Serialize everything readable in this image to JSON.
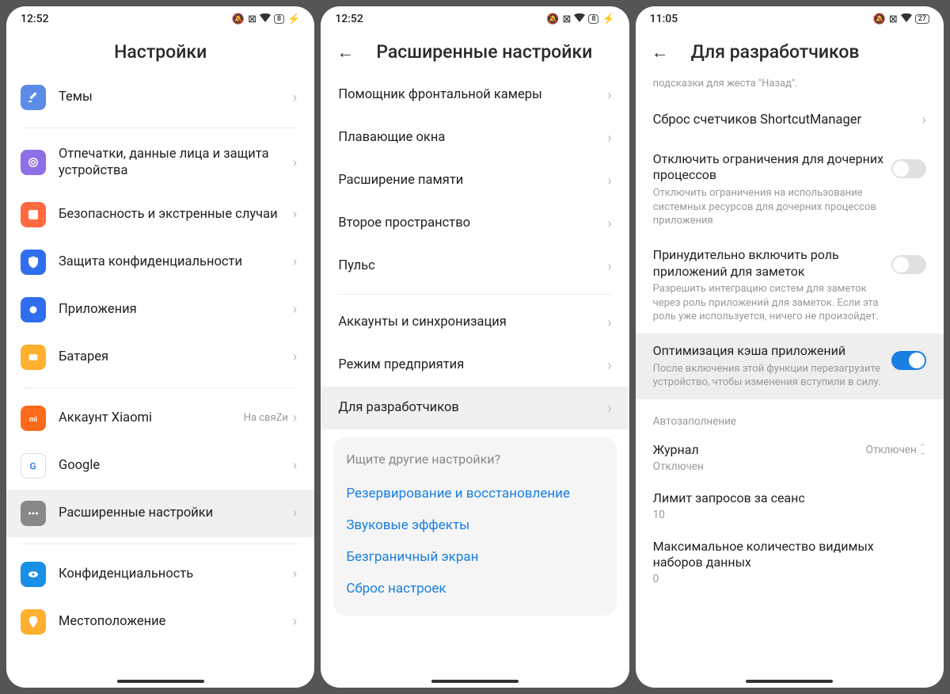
{
  "phone1": {
    "time": "12:52",
    "battery": "8",
    "title": "Настройки",
    "items1": [
      {
        "label": "Темы",
        "color": "#5b8ce8",
        "icon": "brush"
      }
    ],
    "items2": [
      {
        "label": "Отпечатки, данные лица и защита устройства",
        "color": "#8d6fe6",
        "icon": "fingerprint"
      },
      {
        "label": "Безопасность и экстренные случаи",
        "color": "#ff6a3e",
        "icon": "alert"
      },
      {
        "label": "Защита конфиденциальности",
        "color": "#2f6fef",
        "icon": "shield"
      },
      {
        "label": "Приложения",
        "color": "#2f6fef",
        "icon": "apps"
      },
      {
        "label": "Батарея",
        "color": "#ffb02e",
        "icon": "battery"
      }
    ],
    "items3": [
      {
        "label": "Аккаунт Xiaomi",
        "color": "#ff6a1a",
        "icon": "mi",
        "side": "На свяZи"
      },
      {
        "label": "Google",
        "color": "#ffffff",
        "icon": "google"
      },
      {
        "label": "Расширенные настройки",
        "color": "#888888",
        "icon": "dots",
        "highlighted": true
      }
    ],
    "items4": [
      {
        "label": "Конфиденциальность",
        "color": "#1a8fe8",
        "icon": "eye"
      },
      {
        "label": "Местоположение",
        "color": "#ffb02e",
        "icon": "location"
      }
    ]
  },
  "phone2": {
    "time": "12:52",
    "battery": "8",
    "title": "Расширенные настройки",
    "items1": [
      {
        "label": "Помощник фронтальной камеры"
      },
      {
        "label": "Плавающие окна"
      },
      {
        "label": "Расширение памяти"
      },
      {
        "label": "Второе пространство"
      },
      {
        "label": "Пульс"
      }
    ],
    "items2": [
      {
        "label": "Аккаунты и синхронизация"
      },
      {
        "label": "Режим предприятия"
      },
      {
        "label": "Для разработчиков",
        "highlighted": true
      }
    ],
    "suggestions": {
      "prompt": "Ищите другие настройки?",
      "links": [
        "Резервирование и восстановление",
        "Звуковые эффекты",
        "Безграничный экран",
        "Сброс настроек"
      ]
    }
  },
  "phone3": {
    "time": "11:05",
    "battery": "27",
    "title": "Для разработчиков",
    "truncated_desc": "подсказки для жеста \"Назад\".",
    "item_shortcut": "Сброс счетчиков ShortcutManager",
    "toggles": [
      {
        "title": "Отключить ограничения для дочерних процессов",
        "desc": "Отключить ограничения на использование системных ресурсов для дочерних процессов приложения",
        "on": false
      },
      {
        "title": "Принудительно включить роль приложений для заметок",
        "desc": "Разрешить интеграцию систем для заметок через роль приложений для заметок. Если эта роль уже используется, ничего не произойдет.",
        "on": false
      },
      {
        "title": "Оптимизация кэша приложений",
        "desc": "После включения этой функции перезагрузите устройство, чтобы изменения вступили в силу.",
        "on": true,
        "highlighted": true
      }
    ],
    "section_autofill": "Автозаполнение",
    "journal": {
      "label": "Журнал",
      "sub": "Отключен",
      "action": "Отключен"
    },
    "limit": {
      "label": "Лимит запросов за сеанс",
      "sub": "10"
    },
    "maxsets": {
      "label": "Максимальное количество видимых наборов данных",
      "sub": "0"
    }
  }
}
